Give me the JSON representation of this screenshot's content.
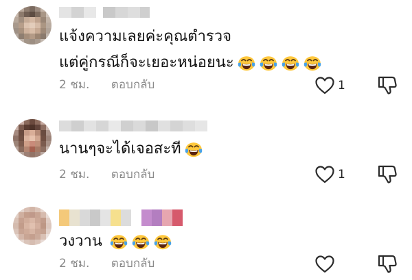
{
  "comments": [
    {
      "text_lines": [
        "แจ้งความเลยค่ะคุณตำรวจ",
        "แต่คู่กรณีก็จะเยอะหน่อยนะ"
      ],
      "emoji_count": 4,
      "time": "2 ชม.",
      "reply_label": "ตอบกลับ",
      "likes": "1"
    },
    {
      "text_lines": [
        "นานๆจะได้เจอสะที"
      ],
      "emoji_count": 1,
      "time": "2 ชม.",
      "reply_label": "ตอบกลับ",
      "likes": "1"
    },
    {
      "text_lines": [
        "วงวาน"
      ],
      "emoji_count": 3,
      "time": "2 ชม.",
      "reply_label": "ตอบกลับ",
      "likes": ""
    }
  ],
  "colors": {
    "text": "#111111",
    "meta": "#8a8a8a",
    "emoji_face": "#ffc83d",
    "emoji_tears": "#49a3e8"
  },
  "icons": {
    "like": "heart-outline-icon",
    "dislike": "thumbs-down-outline-icon",
    "emoji": "face-with-tears-of-joy-emoji"
  }
}
